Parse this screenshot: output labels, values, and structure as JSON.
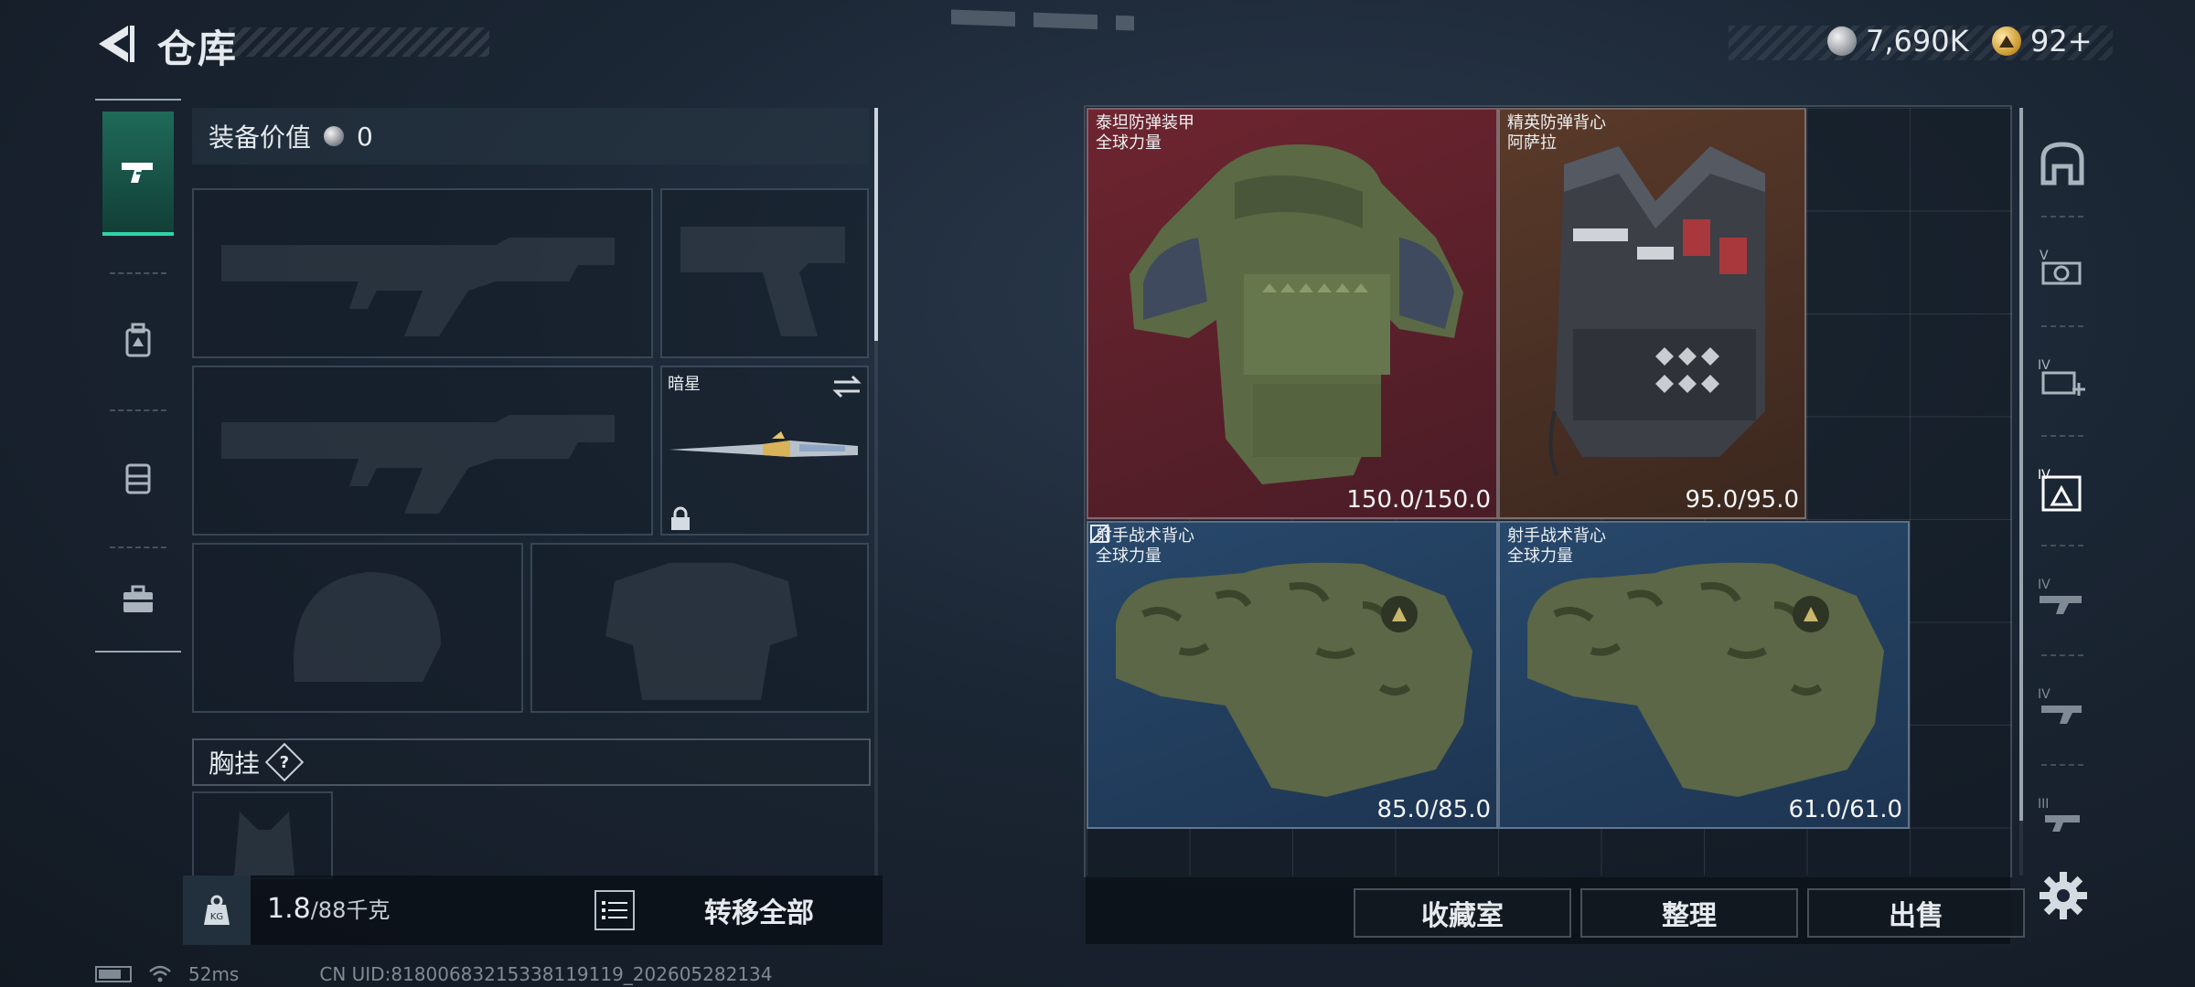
{
  "header": {
    "title": "仓库"
  },
  "currency": {
    "silver": "7,690K",
    "gold": "92+"
  },
  "left_panel": {
    "equipment_value_label": "装备价值",
    "equipment_value": "0",
    "melee_slot_label": "暗星",
    "chest_rig_label": "胸挂",
    "help_symbol": "?"
  },
  "bottom_left": {
    "weight_current": "1.8",
    "weight_max": "/88千克",
    "transfer_all_label": "转移全部"
  },
  "storage_items": [
    {
      "name_line1": "泰坦防弹装甲",
      "name_line2": "全球力量",
      "durability": "150.0/150.0",
      "rarity": "red"
    },
    {
      "name_line1": "精英防弹背心",
      "name_line2": "阿萨拉",
      "durability": "95.0/95.0",
      "rarity": "brown"
    },
    {
      "name_line1": "射手战术背心",
      "name_line2": "全球力量",
      "durability": "85.0/85.0",
      "rarity": "blue"
    },
    {
      "name_line1": "射手战术背心",
      "name_line2": "全球力量",
      "durability": "61.0/61.0",
      "rarity": "blue"
    }
  ],
  "actions": {
    "collection_label": "收藏室",
    "sort_label": "整理",
    "sell_label": "出售"
  },
  "status_bar": {
    "ping": "52ms",
    "uid": "CN UID:8180068321533811911​9_202605282134"
  },
  "right_rail": {
    "items": [
      "all-icon",
      "tier-v-scope-icon",
      "tier-iv-medkit-icon",
      "tier-iv-armor-icon",
      "tier-iv-rifle-icon",
      "tier-iv-smg-icon",
      "tier-iii-gun-icon"
    ]
  },
  "colors": {
    "accent": "#2fd4a6",
    "rarity_red": "#6e2530",
    "rarity_brown": "#5a3a2a",
    "rarity_blue": "#28486b"
  }
}
